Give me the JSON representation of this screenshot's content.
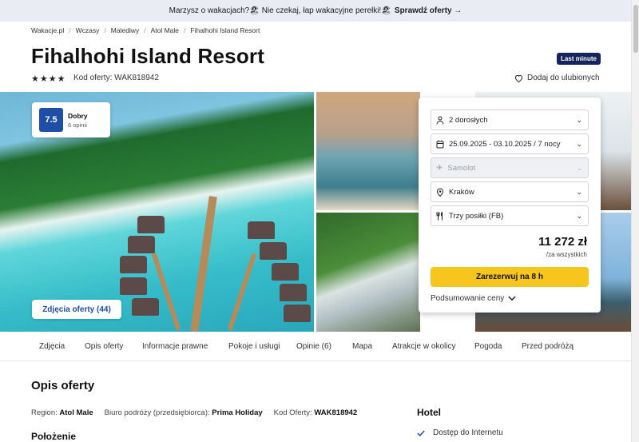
{
  "banner": {
    "text": "Marzysz o wakacjach?🏖 Nie czekaj, łap wakacyjne perełki!🏖",
    "cta": "Sprawdź oferty →"
  },
  "breadcrumb": [
    "Wakacje.pl",
    "Wczasy",
    "Malediwy",
    "Atol Male",
    "Fihalhohi Island Resort"
  ],
  "hotel": {
    "name": "Fihalhohi Island Resort",
    "stars": 4,
    "offer_code_label": "Kod oferty: WAK818942",
    "badge": "Last minute",
    "favorite_label": "Dodaj do ulubionych"
  },
  "rating": {
    "score": "7.5",
    "label": "Dobry",
    "reviews": "6 opinii"
  },
  "photos_button": "Zdjęcia oferty (44)",
  "booking": {
    "travelers": "2 dorosłych",
    "dates": "25.09.2025 - 03.10.2025 / 7 nocy",
    "transport": "Samolot",
    "departure": "Kraków",
    "board": "Trzy posiłki (FB)",
    "price": "11 272 zł",
    "price_note": "/za wszystkich",
    "book_button": "Zarezerwuj na 8 h",
    "summary_label": "Podsumowanie ceny"
  },
  "tabs": [
    "Zdjęcia",
    "Opis oferty",
    "Informacje prawne",
    "Pokoje i usługi",
    "Opinie (6)",
    "Mapa",
    "Atrakcje w okolicy",
    "Pogoda",
    "Przed podróżą"
  ],
  "description": {
    "title": "Opis oferty",
    "region_label": "Region:",
    "region_value": "Atol Male",
    "operator_label": "Biuro podróży (przedsiębiorca):",
    "operator_value": "Prima Holiday",
    "code_label": "Kod Oferty:",
    "code_value": "WAK818942",
    "location_title": "Położenie"
  },
  "hotel_section": {
    "title": "Hotel",
    "amenity": "Dostęp do Internetu"
  },
  "colors": {
    "brand_blue": "#1d4fa6",
    "badge_navy": "#14245c",
    "cta_yellow": "#f6c51e"
  }
}
